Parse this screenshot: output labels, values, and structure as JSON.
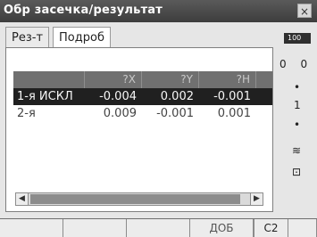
{
  "window": {
    "title": "Обр засечка/результат",
    "close_label": "×"
  },
  "tabs": [
    {
      "label": "Рез-т",
      "active": false
    },
    {
      "label": "Подроб",
      "active": true
    }
  ],
  "table": {
    "headers": [
      "",
      "?X",
      "?Y",
      "?H"
    ],
    "rows": [
      {
        "label": "1-я ИСКЛ",
        "x": "-0.004",
        "y": "0.002",
        "h": "-0.001",
        "selected": true
      },
      {
        "label": "2-я",
        "x": "0.009",
        "y": "-0.001",
        "h": "0.001",
        "selected": false
      }
    ]
  },
  "right_panel": {
    "battery_text": "100",
    "items": [
      {
        "label": "0"
      },
      {
        "label": "0"
      },
      {
        "label": "•"
      },
      {
        "label": "1"
      },
      {
        "label": "•"
      },
      {
        "label": "≋"
      },
      {
        "label": "⊡"
      }
    ]
  },
  "bottom": {
    "softkeys": [
      "",
      "",
      "",
      "ДОБ"
    ],
    "page": "C2"
  }
}
